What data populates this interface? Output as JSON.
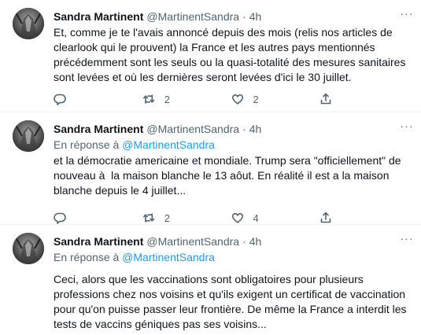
{
  "tweets": [
    {
      "name": "Sandra Martinent",
      "handle": "@MartinentSandra",
      "dot": "·",
      "time": "4h",
      "reply_to_label": "",
      "reply_to_mention": "",
      "text": "Et, comme je te l'avais annoncé depuis des mois (relis nos articles de clearlook qui le prouvent) la France et les autres pays mentionnés précédemment sont les seuls ou la quasi-totalité des mesures sanitaires sont levées et où les dernières seront levées d'ici le 30 juillet.",
      "retweets": "2",
      "likes": "2"
    },
    {
      "name": "Sandra Martinent",
      "handle": "@MartinentSandra",
      "dot": "·",
      "time": "4h",
      "reply_to_label": "En réponse à",
      "reply_to_mention": "@MartinentSandra",
      "text": "et la démocratie americaine et mondiale. Trump sera \"officiellement\" de nouveau à  la maison blanche le 13 aôut. En réalité il est a la maison blanche depuis le 4 juillet...",
      "retweets": "2",
      "likes": "4"
    },
    {
      "name": "Sandra Martinent",
      "handle": "@MartinentSandra",
      "dot": "·",
      "time": "4h",
      "reply_to_label": "En réponse à",
      "reply_to_mention": "@MartinentSandra",
      "text": "Ceci, alors que les vaccinations sont obligatoires pour plusieurs professions chez nos voisins et qu'ils exigent un certificat de vaccination pour qu'on puisse passer leur frontière. De même la France a interdit les tests de vaccins géniques pas ses voisins...",
      "retweets": "",
      "likes": ""
    }
  ],
  "icons": {
    "reply": "reply-icon",
    "retweet": "retweet-icon",
    "like": "heart-icon",
    "share": "share-icon",
    "more": "more-icon"
  },
  "colors": {
    "link": "#1d9bf0",
    "secondary_text": "#536471",
    "primary_text": "#0f1419",
    "divider": "#eff3f4"
  }
}
